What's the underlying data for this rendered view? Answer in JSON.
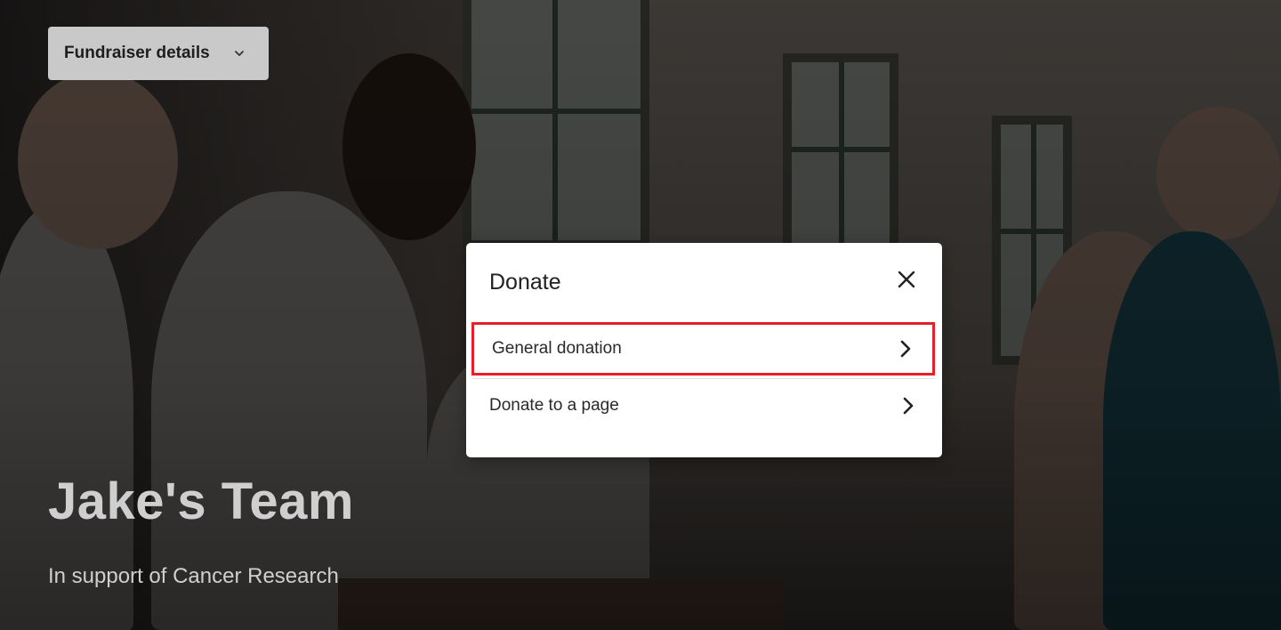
{
  "header": {
    "fundraiser_details_label": "Fundraiser details",
    "dropdown_icon": "chevron-down-icon"
  },
  "hero": {
    "title": "Jake's Team",
    "subtitle": "In support of Cancer Research"
  },
  "modal": {
    "title": "Donate",
    "close_icon": "close-icon",
    "options": [
      {
        "label": "General donation",
        "icon": "chevron-right-icon",
        "highlighted": true
      },
      {
        "label": "Donate to a page",
        "icon": "chevron-right-icon",
        "highlighted": false
      }
    ]
  },
  "colors": {
    "highlight_border": "#e4212b",
    "modal_background": "#ffffff",
    "dropdown_background": "#c9c9c9",
    "hero_text": "#cfcfcf"
  }
}
